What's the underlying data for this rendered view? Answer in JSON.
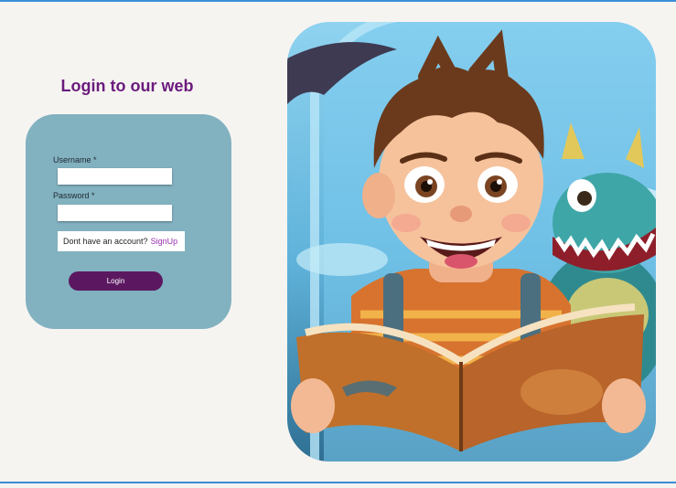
{
  "page": {
    "title": "Login to our web"
  },
  "form": {
    "username_label": "Username *",
    "username_value": "",
    "password_label": "Password *",
    "password_value": "",
    "signup_prompt": "Dont have an account?",
    "signup_link": "SignUp",
    "login_button": "Login"
  },
  "hero": {
    "icon": "illustration-boy-reading-with-dragon"
  },
  "colors": {
    "background": "#f6f4f1",
    "title": "#6a1b7d",
    "card": "#82b1c0",
    "button": "#5b1860",
    "link": "#9a2bb0",
    "frame_line": "#3a8ed6"
  }
}
